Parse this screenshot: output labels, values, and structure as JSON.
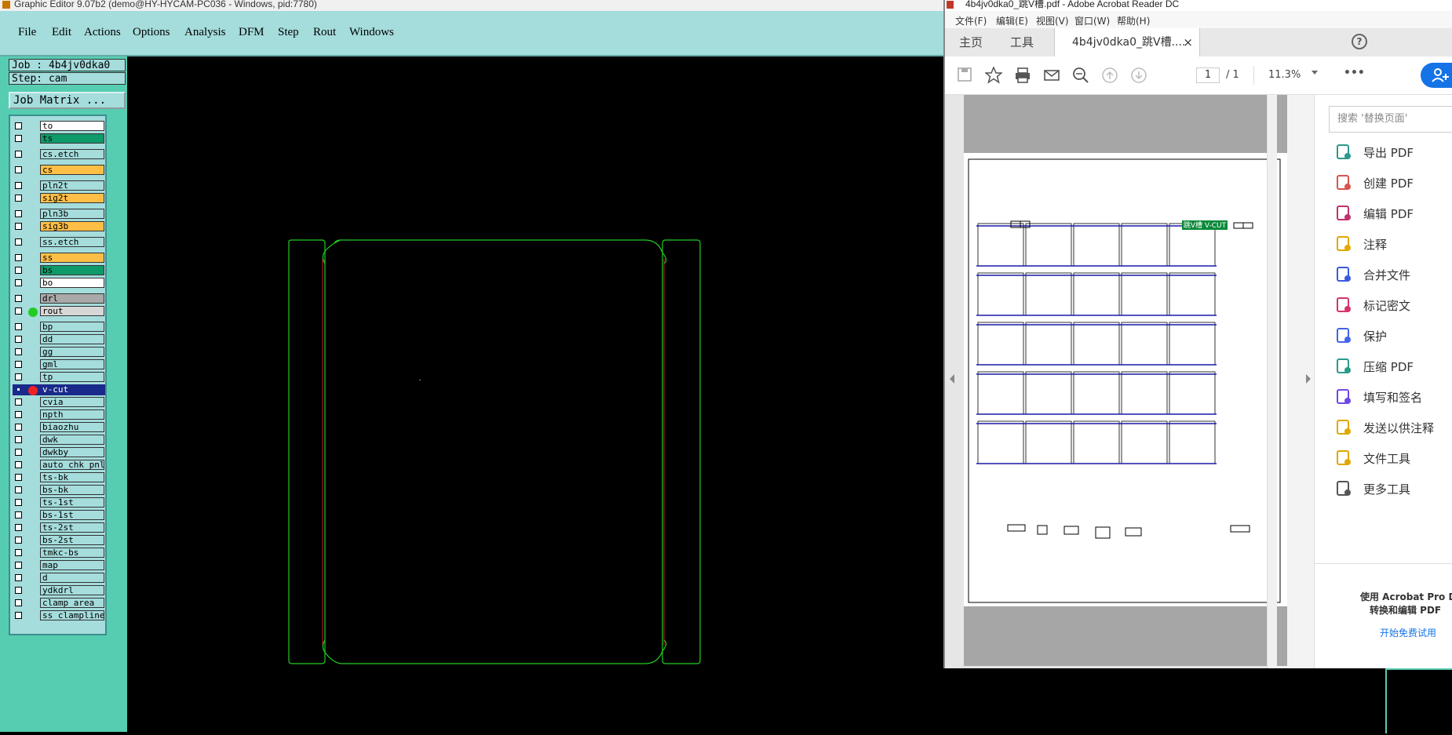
{
  "graphic_editor": {
    "title": "Graphic Editor 9.07b2 (demo@HY-HYCAM-PC036 - Windows, pid:7780)",
    "menu": [
      "File",
      "Edit",
      "Actions",
      "Options",
      "Analysis",
      "DFM",
      "Step",
      "Rout",
      "Windows"
    ],
    "job_label": "Job : 4b4jv0dka0",
    "step_label": "Step: cam",
    "job_matrix_label": "Job Matrix ...",
    "layers": [
      {
        "name": "to",
        "color": "#ffffff"
      },
      {
        "name": "ts",
        "color": "#0f9a6a"
      },
      {
        "name": "cs.etch",
        "color": "#a5dcdc"
      },
      {
        "name": "cs",
        "color": "#ffbf46"
      },
      {
        "name": "pln2t",
        "color": "#a5dcdc"
      },
      {
        "name": "sig2t",
        "color": "#ffbf46"
      },
      {
        "name": "pln3b",
        "color": "#a5dcdc"
      },
      {
        "name": "sig3b",
        "color": "#ffbf46"
      },
      {
        "name": "ss.etch",
        "color": "#a5dcdc"
      },
      {
        "name": "ss",
        "color": "#ffbf46"
      },
      {
        "name": "bs",
        "color": "#0f9a6a"
      },
      {
        "name": "bo",
        "color": "#ffffff"
      },
      {
        "name": "drl",
        "color": "#a9a9a9"
      },
      {
        "name": "rout",
        "color": "#d7d7d7",
        "dot": "#22cc22"
      },
      {
        "name": "bp",
        "color": "#a5dcdc"
      },
      {
        "name": "dd",
        "color": "#a5dcdc"
      },
      {
        "name": "gg",
        "color": "#a5dcdc"
      },
      {
        "name": "gml",
        "color": "#a5dcdc"
      },
      {
        "name": "tp",
        "color": "#a5dcdc"
      },
      {
        "name": "v-cut",
        "color": "#1a2a8a",
        "dot": "#ee2222",
        "selected": true
      },
      {
        "name": "cvia",
        "color": "#a5dcdc"
      },
      {
        "name": "npth",
        "color": "#a5dcdc"
      },
      {
        "name": "biaozhu",
        "color": "#a5dcdc"
      },
      {
        "name": "dwk",
        "color": "#a5dcdc"
      },
      {
        "name": "dwkby",
        "color": "#a5dcdc"
      },
      {
        "name": "auto_chk_pnl",
        "color": "#a5dcdc"
      },
      {
        "name": "ts-bk",
        "color": "#a5dcdc"
      },
      {
        "name": "bs-bk",
        "color": "#a5dcdc"
      },
      {
        "name": "ts-1st",
        "color": "#a5dcdc"
      },
      {
        "name": "bs-1st",
        "color": "#a5dcdc"
      },
      {
        "name": "ts-2st",
        "color": "#a5dcdc"
      },
      {
        "name": "bs-2st",
        "color": "#a5dcdc"
      },
      {
        "name": "tmkc-bs",
        "color": "#a5dcdc"
      },
      {
        "name": "map",
        "color": "#a5dcdc"
      },
      {
        "name": "d",
        "color": "#a5dcdc"
      },
      {
        "name": "ydkdrl",
        "color": "#a5dcdc"
      },
      {
        "name": "clamp_area",
        "color": "#a5dcdc"
      },
      {
        "name": "ss_clampline",
        "color": "#a5dcdc"
      }
    ]
  },
  "acrobat": {
    "title": "4b4jv0dka0_跳V槽.pdf - Adobe Acrobat Reader DC",
    "menu": [
      "文件(F)",
      "编辑(E)",
      "视图(V)",
      "窗口(W)",
      "帮助(H)"
    ],
    "tabs": {
      "home": "主页",
      "tools": "工具",
      "doc": "4b4jv0dka0_跳V槽....",
      "close": "×",
      "help": "?"
    },
    "page_current": "1",
    "page_total": "/ 1",
    "zoom": "11.3%",
    "more": "•••",
    "search_placeholder": "搜索 '替换页面'",
    "tools": [
      {
        "label": "导出 PDF",
        "icon": "export-pdf-icon",
        "color": "#2a9a8a"
      },
      {
        "label": "创建 PDF",
        "icon": "create-pdf-icon",
        "color": "#d9534f"
      },
      {
        "label": "编辑 PDF",
        "icon": "edit-pdf-icon",
        "color": "#c2306e"
      },
      {
        "label": "注释",
        "icon": "comment-icon",
        "color": "#e0a800"
      },
      {
        "label": "合并文件",
        "icon": "combine-files-icon",
        "color": "#3b5bdb"
      },
      {
        "label": "标记密文",
        "icon": "redact-icon",
        "color": "#d6336c"
      },
      {
        "label": "保护",
        "icon": "protect-icon",
        "color": "#4263eb"
      },
      {
        "label": "压缩 PDF",
        "icon": "compress-pdf-icon",
        "color": "#2a9a8a"
      },
      {
        "label": "填写和签名",
        "icon": "fill-sign-icon",
        "color": "#7048e8"
      },
      {
        "label": "发送以供注释",
        "icon": "send-comment-icon",
        "color": "#e0a800"
      },
      {
        "label": "文件工具",
        "icon": "file-tools-icon",
        "color": "#e0a800"
      },
      {
        "label": "更多工具",
        "icon": "more-tools-icon",
        "color": "#555555"
      }
    ],
    "promo_line1": "使用 Acrobat Pro DC",
    "promo_line2": "转换和编辑 PDF",
    "trial_link": "开始免费试用",
    "pdf_badge": "跳V槽 V-CUT"
  }
}
